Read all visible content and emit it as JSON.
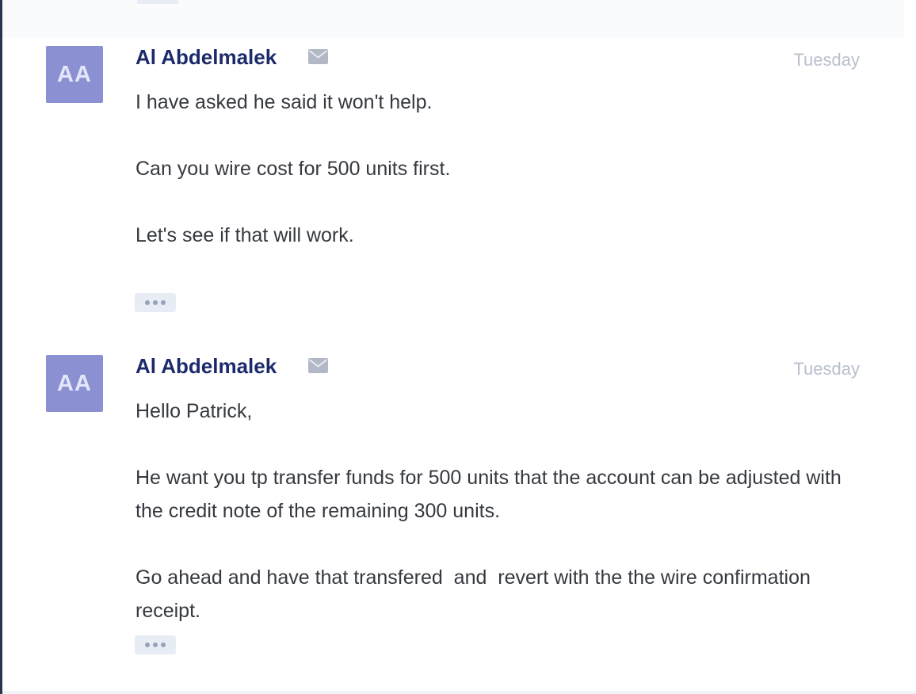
{
  "thread": {
    "messages": [
      {
        "avatar_initials": "AA",
        "sender": "Al Abdelmalek",
        "timestamp": "Tuesday",
        "mail_icon": "envelope-icon",
        "paragraphs": [
          "I have asked he said it won't help.",
          "Can you wire cost for 500 units first.",
          "Let's see if that will work."
        ],
        "more_icon": "ellipsis-icon"
      },
      {
        "avatar_initials": "AA",
        "sender": "Al Abdelmalek",
        "timestamp": "Tuesday",
        "mail_icon": "envelope-icon",
        "paragraphs": [
          "Hello Patrick,",
          "He want you tp transfer funds for 500 units that the account can be adjusted with the credit note of the remaining 300 units.",
          "Go ahead and have that transfered  and  revert with the the wire confirmation receipt."
        ],
        "more_icon": "ellipsis-icon"
      }
    ]
  },
  "colors": {
    "avatar_bg": "#8a90d2",
    "sender_name": "#1c2a6b",
    "timestamp": "#b8bfcc",
    "body_text": "#35393f",
    "more_button_bg": "#e7ecf5"
  }
}
